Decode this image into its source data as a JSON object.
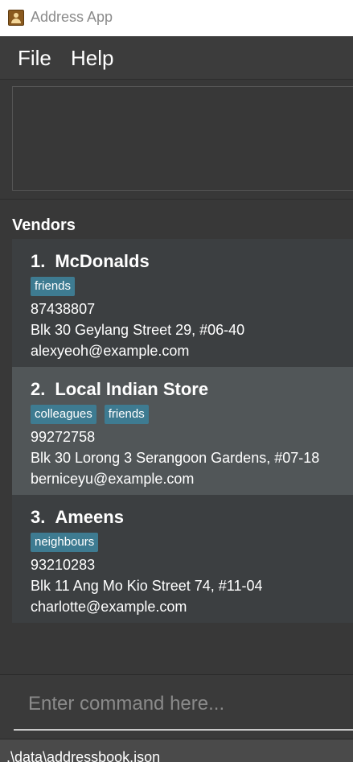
{
  "window": {
    "title": "Address App",
    "icon": "address-book-icon"
  },
  "menu": {
    "file": "File",
    "help": "Help"
  },
  "list": {
    "header": "Vendors",
    "items": [
      {
        "index": "1.",
        "name": "McDonalds",
        "tags": [
          "friends"
        ],
        "phone": "87438807",
        "address": "Blk 30 Geylang Street 29, #06-40",
        "email": "alexyeoh@example.com"
      },
      {
        "index": "2.",
        "name": "Local Indian Store",
        "tags": [
          "colleagues",
          "friends"
        ],
        "phone": "99272758",
        "address": "Blk 30 Lorong 3 Serangoon Gardens, #07-18",
        "email": "berniceyu@example.com"
      },
      {
        "index": "3.",
        "name": "Ameens",
        "tags": [
          "neighbours"
        ],
        "phone": "93210283",
        "address": "Blk 11 Ang Mo Kio Street 74, #11-04",
        "email": "charlotte@example.com"
      }
    ]
  },
  "command": {
    "placeholder": "Enter command here..."
  },
  "status": {
    "path": ".\\data\\addressbook.json"
  },
  "colors": {
    "tag": "#3e7b91",
    "background": "#383838",
    "card_odd": "#3c3f41",
    "card_even": "#515658"
  }
}
